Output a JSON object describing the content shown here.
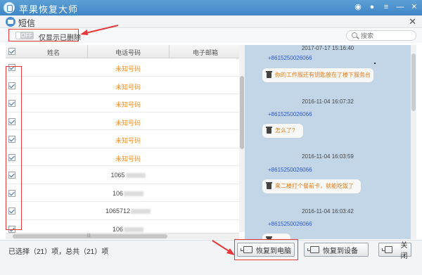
{
  "window": {
    "title": "苹果恢复大师",
    "controls": [
      "weibo-icon",
      "chat-icon",
      "menu-icon",
      "minimize-icon",
      "close-icon"
    ]
  },
  "section": {
    "title": "短信"
  },
  "filter": {
    "toggle_label": "OFF",
    "label": "仅显示已删除"
  },
  "search": {
    "placeholder": "搜索"
  },
  "table": {
    "headers": [
      "姓名",
      "电话号码",
      "电子邮箱"
    ],
    "rows": [
      {
        "phone": "未知号码",
        "type": "unknown",
        "checked": true
      },
      {
        "phone": "未知号码",
        "type": "unknown",
        "checked": true
      },
      {
        "phone": "未知号码",
        "type": "unknown",
        "checked": true
      },
      {
        "phone": "未知号码",
        "type": "unknown",
        "checked": true
      },
      {
        "phone": "未知号码",
        "type": "unknown",
        "checked": true
      },
      {
        "phone": "未知号码",
        "type": "unknown",
        "checked": true
      },
      {
        "phone": "1065",
        "type": "number",
        "checked": true
      },
      {
        "phone": "106",
        "type": "number",
        "checked": true
      },
      {
        "phone": "1065712",
        "type": "number",
        "checked": true
      },
      {
        "phone": "106",
        "type": "number",
        "checked": true
      }
    ],
    "scroll_grip": "|||"
  },
  "messages": [
    {
      "time": "2017-07-17 15:16:40",
      "sender": "+8615250026066",
      "text": "你的工作服还有钥匙放在了楼下服务台"
    },
    {
      "time": "2016-11-04 16:07:32",
      "sender": "+8615250026066",
      "text": "怎么了?"
    },
    {
      "time": "2016-11-04 16:03:59",
      "sender": "+8615250026066",
      "text": "来二楼打个餐前卡，就能吃饭了"
    },
    {
      "time": "2016-11-04 16:03:42",
      "sender": "+8615250026066",
      "text": ""
    }
  ],
  "footer": {
    "status": "已选择（21）项，总共（21）项",
    "restore_pc": "恢复到电脑",
    "restore_device": "恢复到设备",
    "close": "关闭"
  },
  "colors": {
    "accent": "#3f86c6",
    "unknown_number": "#f0902a",
    "sender": "#2d56c8",
    "annotation": "#e6393d",
    "chat_bg": "#c2d6e8"
  }
}
